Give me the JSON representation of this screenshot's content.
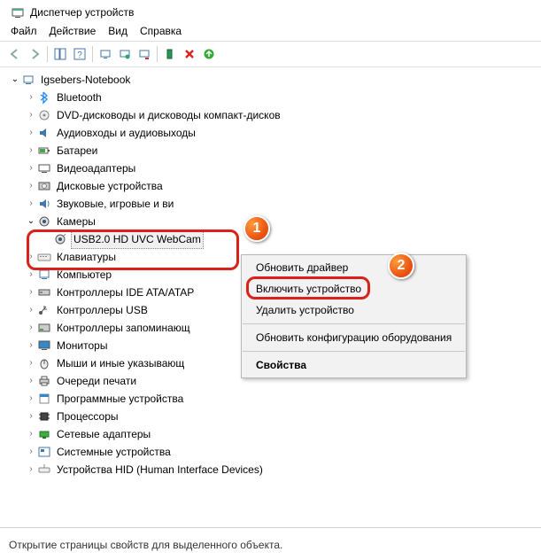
{
  "window": {
    "title": "Диспетчер устройств"
  },
  "menubar": {
    "items": [
      "Файл",
      "Действие",
      "Вид",
      "Справка"
    ]
  },
  "tree": {
    "root": "Igsebers-Notebook",
    "nodes": [
      {
        "label": "Bluetooth",
        "icon": "bt"
      },
      {
        "label": "DVD-дисководы и дисководы компакт-дисков",
        "icon": "dvd"
      },
      {
        "label": "Аудиовходы и аудиовыходы",
        "icon": "audio"
      },
      {
        "label": "Батареи",
        "icon": "bat"
      },
      {
        "label": "Видеоадаптеры",
        "icon": "gpu"
      },
      {
        "label": "Дисковые устройства",
        "icon": "disk"
      },
      {
        "label": "Звуковые, игровые и видеоустройства",
        "icon": "snd",
        "truncated": "Звуковые, игровые и ви"
      },
      {
        "label": "Камеры",
        "icon": "cam",
        "expanded": true,
        "children": [
          {
            "label": "USB2.0 HD UVC WebCam",
            "icon": "camdev",
            "selected": true
          }
        ]
      },
      {
        "label": "Клавиатуры",
        "icon": "kbd"
      },
      {
        "label": "Компьютер",
        "icon": "pc"
      },
      {
        "label": "Контроллеры IDE ATA/ATAPI",
        "icon": "ide",
        "truncated": "Контроллеры IDE ATA/ATAP"
      },
      {
        "label": "Контроллеры USB",
        "icon": "usb"
      },
      {
        "label": "Контроллеры запоминающих устройств",
        "icon": "stor",
        "truncated": "Контроллеры запоминающ"
      },
      {
        "label": "Мониторы",
        "icon": "mon"
      },
      {
        "label": "Мыши и иные указывающие устройства",
        "icon": "mouse",
        "truncated": "Мыши и иные указывающ"
      },
      {
        "label": "Очереди печати",
        "icon": "print"
      },
      {
        "label": "Программные устройства",
        "icon": "soft"
      },
      {
        "label": "Процессоры",
        "icon": "cpu"
      },
      {
        "label": "Сетевые адаптеры",
        "icon": "net"
      },
      {
        "label": "Системные устройства",
        "icon": "sys"
      },
      {
        "label": "Устройства HID (Human Interface Devices)",
        "icon": "hid"
      }
    ]
  },
  "context_menu": {
    "items": [
      "Обновить драйвер",
      "Включить устройство",
      "Удалить устройство",
      "Обновить конфигурацию оборудования",
      "Свойства"
    ],
    "highlighted_index": 1,
    "bold_index": 4
  },
  "statusbar": {
    "text": "Открытие страницы свойств для выделенного объекта."
  },
  "annotations": {
    "badge1": "1",
    "badge2": "2"
  }
}
